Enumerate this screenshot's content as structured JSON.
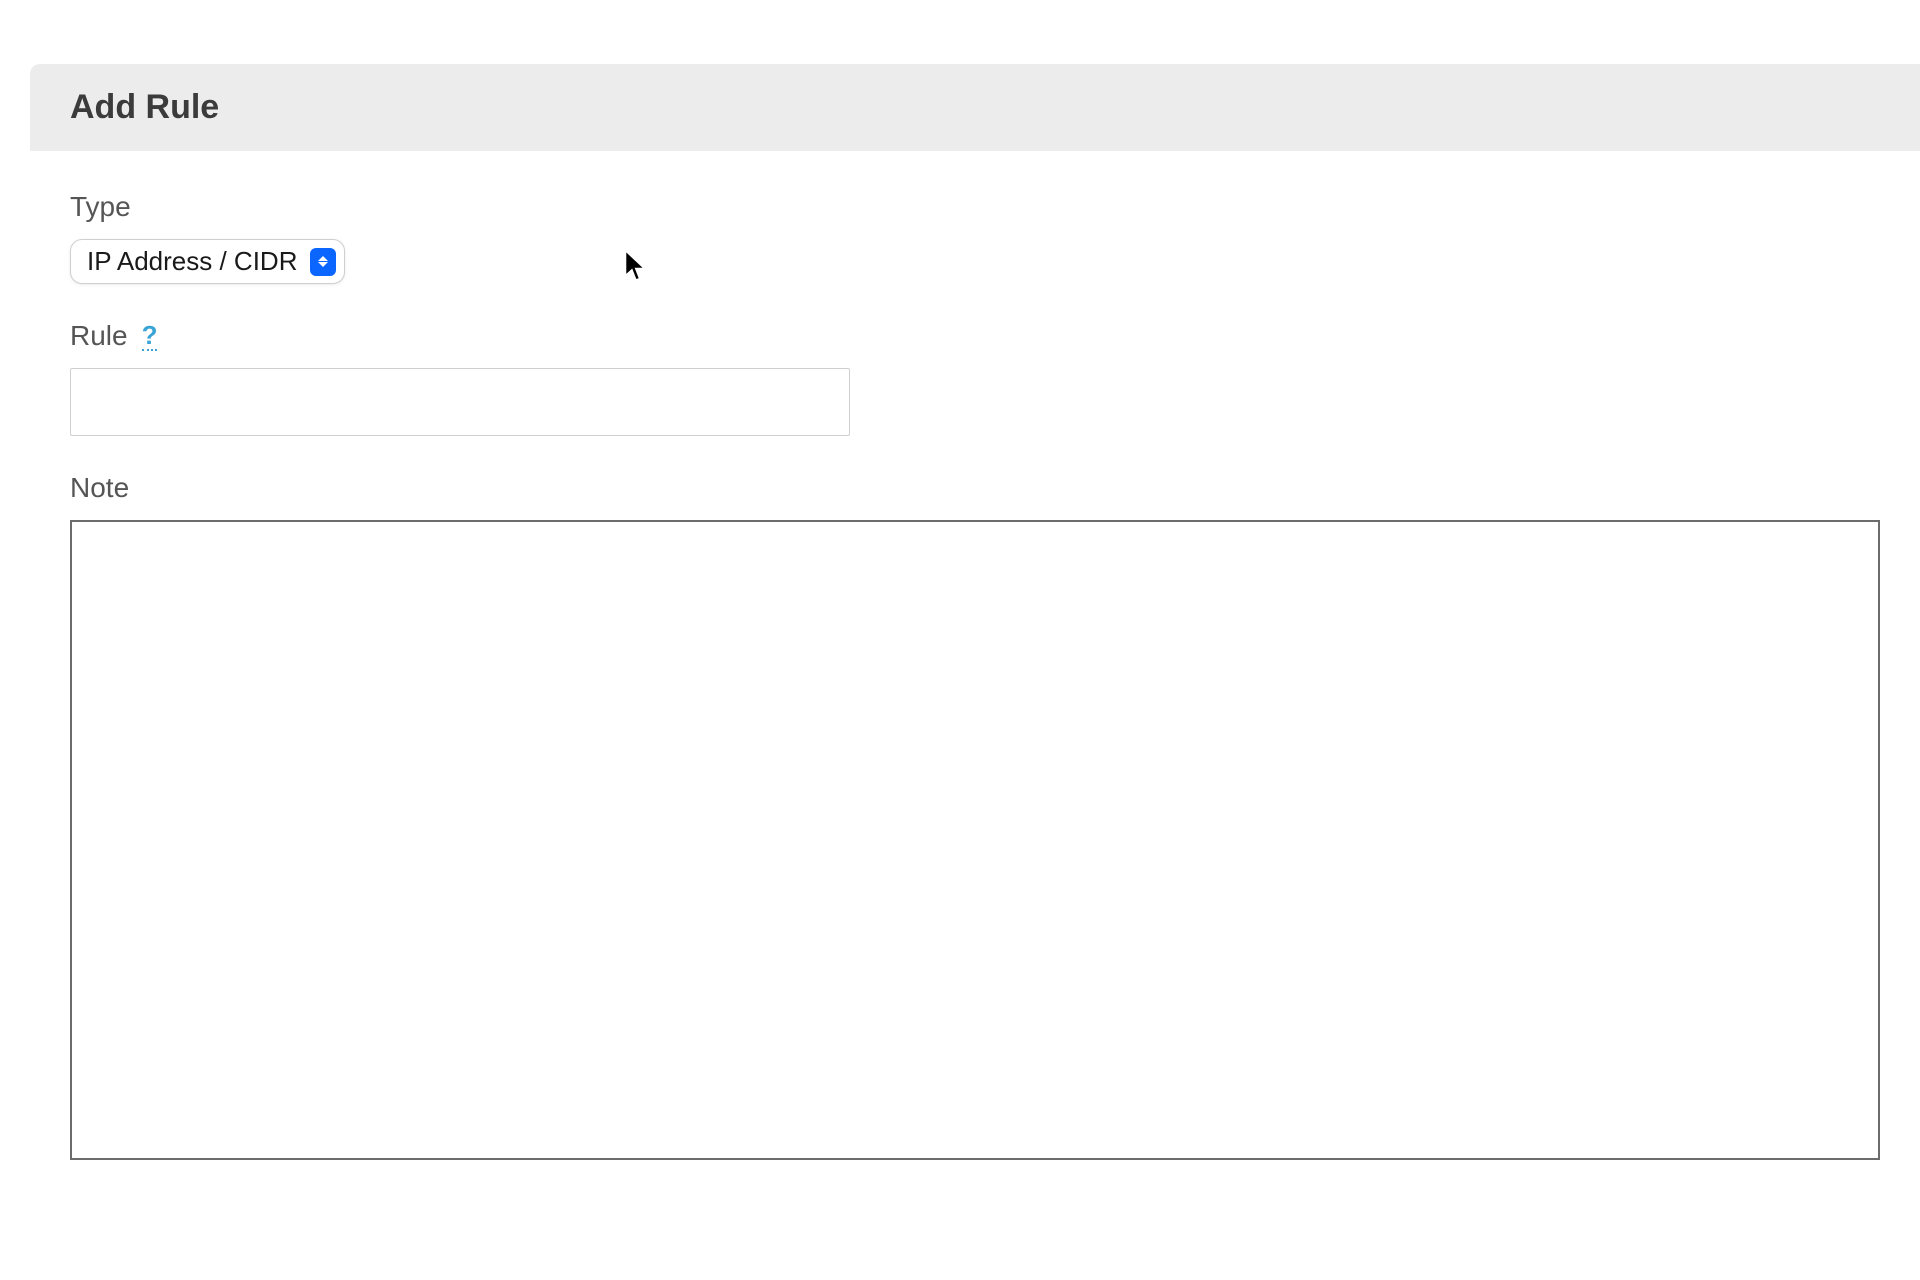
{
  "panel": {
    "title": "Add Rule"
  },
  "fields": {
    "type": {
      "label": "Type",
      "selected": "IP Address / CIDR"
    },
    "rule": {
      "label": "Rule",
      "help": "?",
      "value": ""
    },
    "note": {
      "label": "Note",
      "value": ""
    }
  }
}
